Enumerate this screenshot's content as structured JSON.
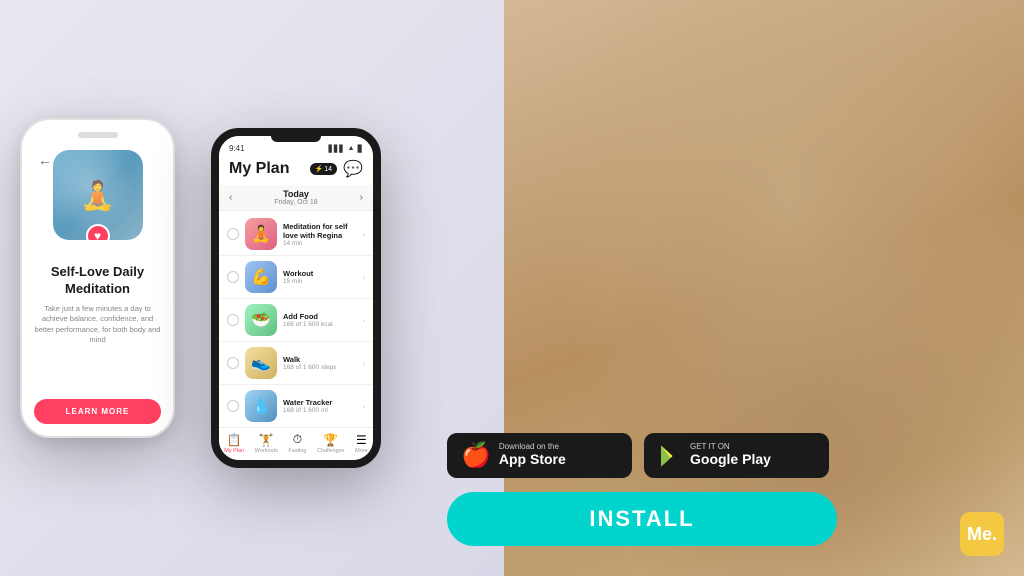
{
  "background": {
    "left_color": "#e8e8f0",
    "right_color": "#b89060"
  },
  "phone_white": {
    "back_btn": "←",
    "title": "Self-Love Daily\nMeditation",
    "description": "Take just a few minutes a day to achieve balance, confidence, and better performance, for both body and mind",
    "learn_more": "LEARN MORE",
    "heart": "♥"
  },
  "phone_dark": {
    "time": "9:41",
    "signal": "▋▋▋",
    "wifi": "▲",
    "battery": "▊",
    "title": "My Plan",
    "lightning": "⚡",
    "count": "14",
    "message_icon": "💬",
    "today_label": "Today",
    "today_date": "Friday, Oct 18",
    "activities": [
      {
        "name": "Meditation for self love with Regina",
        "sub": "14 min",
        "emoji": "🧘",
        "thumb_class": "activity-thumb-meditation"
      },
      {
        "name": "Workout",
        "sub": "15 min",
        "emoji": "💪",
        "thumb_class": "activity-thumb-workout"
      },
      {
        "name": "Add Food",
        "sub": "168 of 1 600 kcal",
        "emoji": "🥗",
        "thumb_class": "activity-thumb-food"
      },
      {
        "name": "Walk",
        "sub": "168 of 1 600 steps",
        "emoji": "👟",
        "thumb_class": "activity-thumb-walk"
      },
      {
        "name": "Water Tracker",
        "sub": "168 of 1 600 ml",
        "emoji": "💧",
        "thumb_class": "activity-thumb-water"
      }
    ],
    "nav_items": [
      {
        "label": "My Plan",
        "icon": "📋",
        "active": true
      },
      {
        "label": "Workouts",
        "icon": "🏋️",
        "active": false
      },
      {
        "label": "Fasting",
        "icon": "⏱",
        "active": false
      },
      {
        "label": "Challenges",
        "icon": "🏆",
        "active": false
      },
      {
        "label": "More",
        "icon": "☰",
        "active": false
      }
    ]
  },
  "store_buttons": {
    "appstore": {
      "top_text": "Download on the",
      "main_text": "App Store",
      "icon": "🍎"
    },
    "googleplay": {
      "top_text": "GET IT ON",
      "main_text": "Google Play",
      "icon": "▶"
    }
  },
  "install_button": {
    "label": "INSTALL"
  },
  "me_logo": {
    "text": "Me."
  }
}
